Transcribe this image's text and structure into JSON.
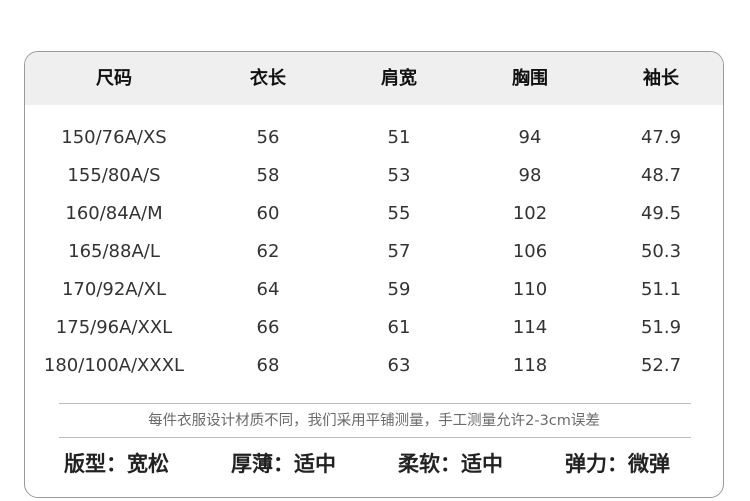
{
  "table": {
    "columns": [
      "尺码",
      "衣长",
      "肩宽",
      "胸围",
      "袖长"
    ],
    "rows": [
      [
        "150/76A/XS",
        "56",
        "51",
        "94",
        "47.9"
      ],
      [
        "155/80A/S",
        "58",
        "53",
        "98",
        "48.7"
      ],
      [
        "160/84A/M",
        "60",
        "55",
        "102",
        "49.5"
      ],
      [
        "165/88A/L",
        "62",
        "57",
        "106",
        "50.3"
      ],
      [
        "170/92A/XL",
        "64",
        "59",
        "110",
        "51.1"
      ],
      [
        "175/96A/XXL",
        "66",
        "61",
        "114",
        "51.9"
      ],
      [
        "180/100A/XXXL",
        "68",
        "63",
        "118",
        "52.7"
      ]
    ]
  },
  "note": "每件衣服设计材质不同，我们采用平铺测量，手工测量允许2-3cm误差",
  "features": [
    "版型：宽松",
    "厚薄：适中",
    "柔软：适中",
    "弹力：微弹"
  ]
}
